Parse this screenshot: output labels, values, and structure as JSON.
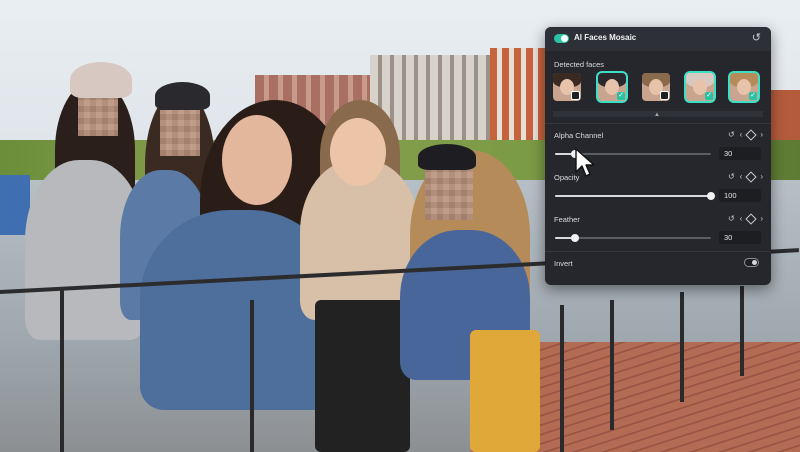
{
  "panel": {
    "title": "AI Faces Mosaic",
    "enabled": true,
    "reset_icon": "reset-icon",
    "detected_faces_label": "Detected faces",
    "faces": [
      {
        "selected": false,
        "checked": false
      },
      {
        "selected": true,
        "checked": true
      },
      {
        "selected": false,
        "checked": false
      },
      {
        "selected": true,
        "checked": true
      },
      {
        "selected": true,
        "checked": true
      }
    ],
    "accent_color": "#29c2a5"
  },
  "controls": {
    "alpha": {
      "label": "Alpha Channel",
      "value": "30",
      "level": 0.13
    },
    "opacity": {
      "label": "Opacity",
      "value": "100",
      "level": 1.0
    },
    "feather": {
      "label": "Feather",
      "value": "30",
      "level": 0.13
    },
    "invert": {
      "label": "Invert",
      "enabled": false
    }
  },
  "icons": {
    "reset": "reset-icon",
    "prev_keyframe": "chevron-left-icon",
    "add_keyframe": "diamond-icon",
    "next_keyframe": "chevron-right-icon",
    "pointer": "mouse-pointer-icon"
  }
}
